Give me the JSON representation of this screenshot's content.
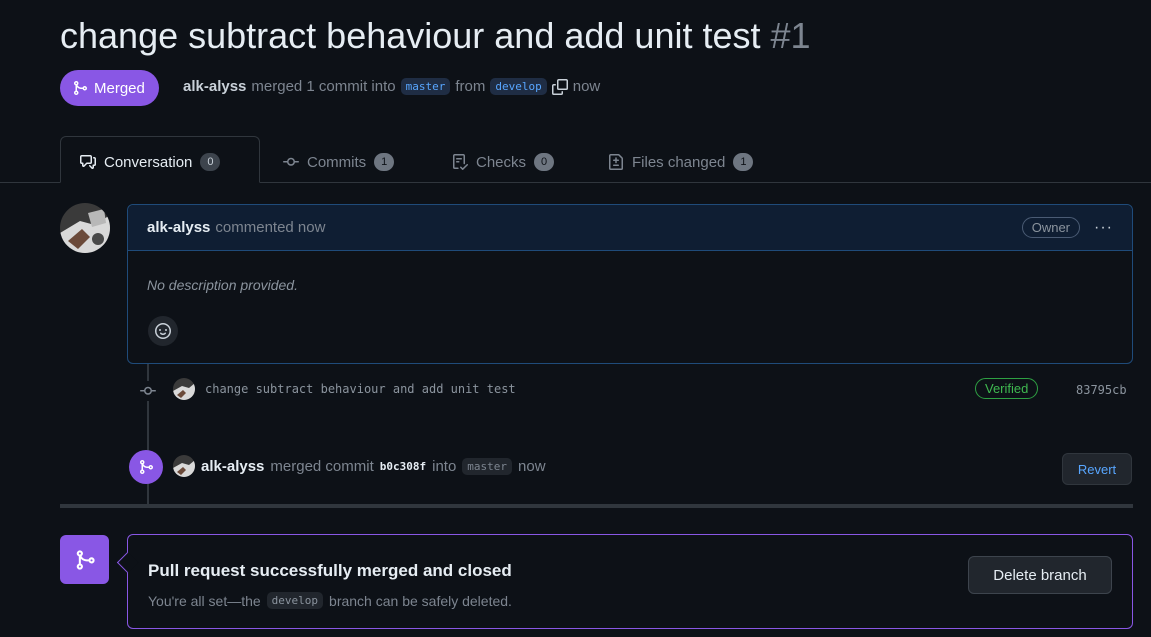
{
  "pr": {
    "title": "change subtract behaviour and add unit test",
    "number": "#1",
    "state_label": "Merged",
    "author": "alk-alyss",
    "merge_text": "merged 1 commit into",
    "base_branch": "master",
    "from_text": "from",
    "head_branch": "develop",
    "time": "now"
  },
  "tabs": [
    {
      "label": "Conversation",
      "count": "0",
      "icon": "comment-discussion-icon"
    },
    {
      "label": "Commits",
      "count": "1",
      "icon": "git-commit-icon"
    },
    {
      "label": "Checks",
      "count": "0",
      "icon": "checklist-icon"
    },
    {
      "label": "Files changed",
      "count": "1",
      "icon": "file-diff-icon"
    }
  ],
  "comment": {
    "author": "alk-alyss",
    "action": "commented now",
    "role_badge": "Owner",
    "menu": "···",
    "body": "No description provided."
  },
  "commit": {
    "message": "change subtract behaviour and add unit test",
    "verified_label": "Verified",
    "sha": "83795cb"
  },
  "merge_event": {
    "author": "alk-alyss",
    "text_before": "merged commit",
    "sha": "b0c308f",
    "text_into": "into",
    "branch": "master",
    "time": "now",
    "revert_label": "Revert"
  },
  "merged_box": {
    "title": "Pull request successfully merged and closed",
    "sub_before": "You're all set—the",
    "branch": "develop",
    "sub_after": "branch can be safely deleted.",
    "delete_label": "Delete branch"
  },
  "colors": {
    "background": "#0d1117",
    "merged_purple": "#8957e5",
    "link_blue": "#58a6ff",
    "verified_green": "#3fb950"
  }
}
